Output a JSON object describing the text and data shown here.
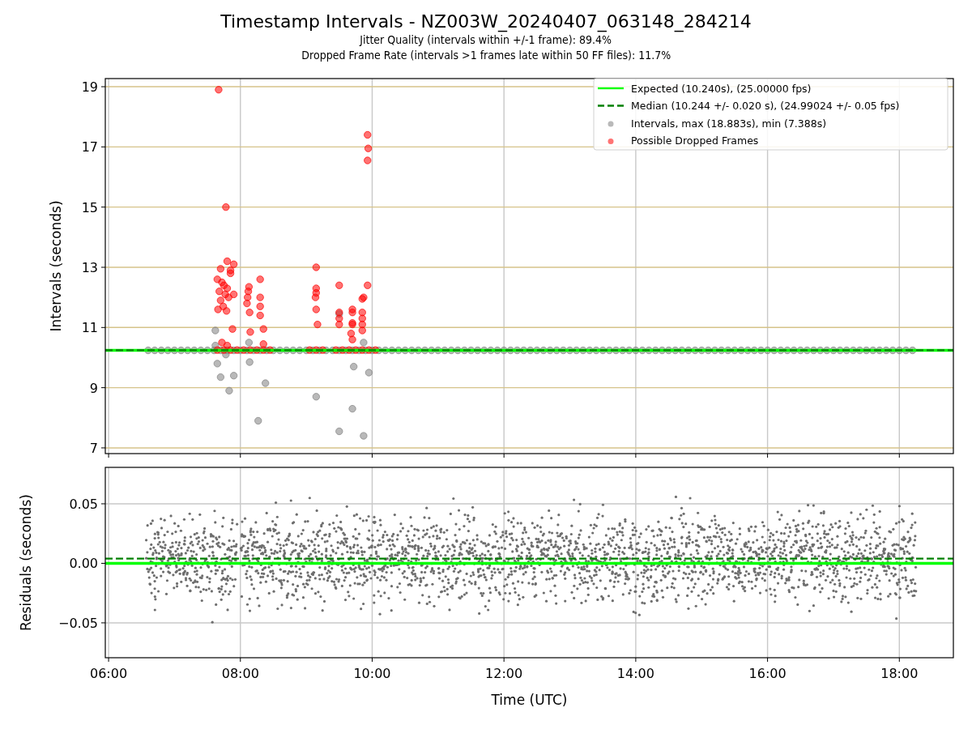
{
  "title": "Timestamp Intervals - NZ003W_20240407_063148_284214",
  "subtitles": [
    "Jitter Quality (intervals within +/-1 frame): 89.4%",
    "Dropped Frame Rate (intervals >1 frames late within 50 FF files): 11.7%"
  ],
  "charts": [
    {
      "chart_data": {
        "type": "scatter",
        "ylabel": "Intervals (seconds)",
        "xlim": [
          5.95,
          18.82
        ],
        "ylim": [
          6.81,
          19.27
        ],
        "grid": true,
        "legend": true,
        "yticks": [
          {
            "value": 7,
            "label": "7"
          },
          {
            "value": 9,
            "label": "9"
          },
          {
            "value": 11,
            "label": "11"
          },
          {
            "value": 13,
            "label": "13"
          },
          {
            "value": 15,
            "label": "15"
          },
          {
            "value": 17,
            "label": "17"
          },
          {
            "value": 19,
            "label": "19"
          }
        ],
        "series": [
          {
            "name": "Expected (10.240s), (25.00000 fps)",
            "color": "#00ff00",
            "type": "line",
            "line_style": "solid",
            "x": [
              5.95,
              18.82
            ],
            "values": [
              10.24,
              10.24
            ]
          },
          {
            "name": "Median (10.244 +/- 0.020 s), (24.99024 +/- 0.05 fps)",
            "color": "#008000",
            "type": "line",
            "line_style": "dashed",
            "x": [
              5.95,
              18.82
            ],
            "values": [
              10.244,
              10.244
            ]
          },
          {
            "name": "Intervals, max (18.883s), min (7.388s)",
            "color": "#808080",
            "type": "scatter",
            "x": [
              7.62,
              7.62,
              7.65,
              7.7,
              7.9,
              7.83,
              7.78,
              8.13,
              8.14,
              8.38,
              8.27,
              9.15,
              9.5,
              9.5,
              9.72,
              9.7,
              9.87,
              9.87,
              9.95,
              6.6,
              6.7,
              6.8,
              6.9,
              7.0,
              7.1,
              7.2,
              7.3,
              7.4,
              7.5,
              7.6,
              7.7,
              7.8,
              7.9,
              8.0,
              8.1,
              8.2,
              8.3,
              8.4,
              8.5,
              8.6,
              8.7,
              8.8,
              8.9,
              9.0,
              9.1,
              9.2,
              9.3,
              9.4,
              9.5,
              9.6,
              9.7,
              9.8,
              9.9,
              10.0,
              10.1,
              10.2,
              10.3,
              10.4,
              10.5,
              10.6,
              10.7,
              10.8,
              10.9,
              11.0,
              11.1,
              11.2,
              11.3,
              11.4,
              11.5,
              11.6,
              11.7,
              11.8,
              11.9,
              12.0,
              12.1,
              12.2,
              12.3,
              12.4,
              12.5,
              12.6,
              12.7,
              12.8,
              12.9,
              13.0,
              13.1,
              13.2,
              13.3,
              13.4,
              13.5,
              13.6,
              13.7,
              13.8,
              13.9,
              14.0,
              14.1,
              14.2,
              14.3,
              14.4,
              14.5,
              14.6,
              14.7,
              14.8,
              14.9,
              15.0,
              15.1,
              15.2,
              15.3,
              15.4,
              15.5,
              15.6,
              15.7,
              15.8,
              15.9,
              16.0,
              16.1,
              16.2,
              16.3,
              16.4,
              16.5,
              16.6,
              16.7,
              16.8,
              16.9,
              17.0,
              17.1,
              17.2,
              17.3,
              17.4,
              17.5,
              17.6,
              17.7,
              17.8,
              17.9,
              18.0,
              18.1,
              18.2
            ],
            "values": [
              10.9,
              10.4,
              9.8,
              9.35,
              9.4,
              8.9,
              10.1,
              10.5,
              9.85,
              9.15,
              7.9,
              8.7,
              11.45,
              7.55,
              9.7,
              8.3,
              10.5,
              7.4,
              9.5,
              10.24,
              10.24,
              10.24,
              10.24,
              10.24,
              10.24,
              10.24,
              10.24,
              10.24,
              10.24,
              10.24,
              10.24,
              10.24,
              10.24,
              10.24,
              10.24,
              10.24,
              10.24,
              10.24,
              10.24,
              10.24,
              10.24,
              10.24,
              10.24,
              10.24,
              10.24,
              10.24,
              10.24,
              10.24,
              10.24,
              10.24,
              10.24,
              10.24,
              10.24,
              10.24,
              10.24,
              10.24,
              10.24,
              10.24,
              10.24,
              10.24,
              10.24,
              10.24,
              10.24,
              10.24,
              10.24,
              10.24,
              10.24,
              10.24,
              10.24,
              10.24,
              10.24,
              10.24,
              10.24,
              10.24,
              10.24,
              10.24,
              10.24,
              10.24,
              10.24,
              10.24,
              10.24,
              10.24,
              10.24,
              10.24,
              10.24,
              10.24,
              10.24,
              10.24,
              10.24,
              10.24,
              10.24,
              10.24,
              10.24,
              10.24,
              10.24,
              10.24,
              10.24,
              10.24,
              10.24,
              10.24,
              10.24,
              10.24,
              10.24,
              10.24,
              10.24,
              10.24,
              10.24,
              10.24,
              10.24,
              10.24,
              10.24,
              10.24,
              10.24,
              10.24,
              10.24,
              10.24,
              10.24,
              10.24,
              10.24,
              10.24,
              10.24,
              10.24,
              10.24,
              10.24,
              10.24,
              10.24,
              10.24,
              10.24,
              10.24,
              10.24,
              10.24,
              10.24,
              10.24,
              10.24,
              10.24,
              10.24
            ]
          },
          {
            "name": "Possible Dropped Frames",
            "color": "#ff0000",
            "type": "scatter",
            "x": [
              7.67,
              7.78,
              7.8,
              7.9,
              7.7,
              7.85,
              7.65,
              7.72,
              7.75,
              7.8,
              7.68,
              7.77,
              7.82,
              7.7,
              7.74,
              7.66,
              7.79,
              7.85,
              7.9,
              7.88,
              7.72,
              7.8,
              8.13,
              8.12,
              8.11,
              8.1,
              8.14,
              8.15,
              8.3,
              8.3,
              8.3,
              8.3,
              8.35,
              8.35,
              9.15,
              9.15,
              9.15,
              9.14,
              9.15,
              9.17,
              9.5,
              9.5,
              9.5,
              9.5,
              9.7,
              9.7,
              9.7,
              9.7,
              9.68,
              9.7,
              9.85,
              9.87,
              9.85,
              9.85,
              9.85,
              9.85,
              9.93,
              9.94,
              9.93,
              9.93,
              7.65,
              7.75,
              7.85,
              7.95,
              8.05,
              8.15,
              8.25,
              8.35,
              8.45,
              9.05,
              9.15,
              9.25,
              9.45,
              9.55,
              9.65,
              9.75,
              9.85,
              9.95,
              10.05
            ],
            "values": [
              18.9,
              15.0,
              13.2,
              13.1,
              12.95,
              12.9,
              12.6,
              12.5,
              12.4,
              12.3,
              12.2,
              12.1,
              12.0,
              11.9,
              11.7,
              11.6,
              11.55,
              12.8,
              12.1,
              10.95,
              10.5,
              10.4,
              12.35,
              12.2,
              12.0,
              11.8,
              11.5,
              10.85,
              12.6,
              12.0,
              11.7,
              11.4,
              10.95,
              10.45,
              13.0,
              12.3,
              12.15,
              12.0,
              11.6,
              11.1,
              12.4,
              11.5,
              11.3,
              11.1,
              11.6,
              11.5,
              11.15,
              11.1,
              10.8,
              10.6,
              11.95,
              12.0,
              11.5,
              11.3,
              11.1,
              10.9,
              16.55,
              16.95,
              17.4,
              12.4,
              10.25,
              10.25,
              10.25,
              10.25,
              10.25,
              10.25,
              10.25,
              10.25,
              10.25,
              10.25,
              10.25,
              10.25,
              10.25,
              10.25,
              10.25,
              10.25,
              10.25,
              10.25,
              10.25
            ]
          }
        ]
      }
    },
    {
      "chart_data": {
        "type": "scatter",
        "xlabel": "Time (UTC)",
        "ylabel": "Residuals (seconds)",
        "xlim": [
          5.95,
          18.82
        ],
        "ylim": [
          -0.0793,
          0.0806
        ],
        "grid": true,
        "xticks": [
          {
            "value": 6,
            "label": "06:00"
          },
          {
            "value": 8,
            "label": "08:00"
          },
          {
            "value": 10,
            "label": "10:00"
          },
          {
            "value": 12,
            "label": "12:00"
          },
          {
            "value": 14,
            "label": "14:00"
          },
          {
            "value": 16,
            "label": "16:00"
          },
          {
            "value": 18,
            "label": "18:00"
          }
        ],
        "yticks": [
          {
            "value": -0.05,
            "label": "−0.05"
          },
          {
            "value": 0,
            "label": "0.00"
          },
          {
            "value": 0.05,
            "label": "0.05"
          }
        ],
        "series": [
          {
            "color": "#00ff00",
            "type": "line",
            "line_style": "solid",
            "x": [
              5.95,
              18.82
            ],
            "values": [
              0,
              0
            ]
          },
          {
            "color": "#008000",
            "type": "line",
            "line_style": "dashed",
            "x": [
              5.95,
              18.82
            ],
            "values": [
              0.004,
              0.004
            ]
          }
        ]
      }
    }
  ]
}
